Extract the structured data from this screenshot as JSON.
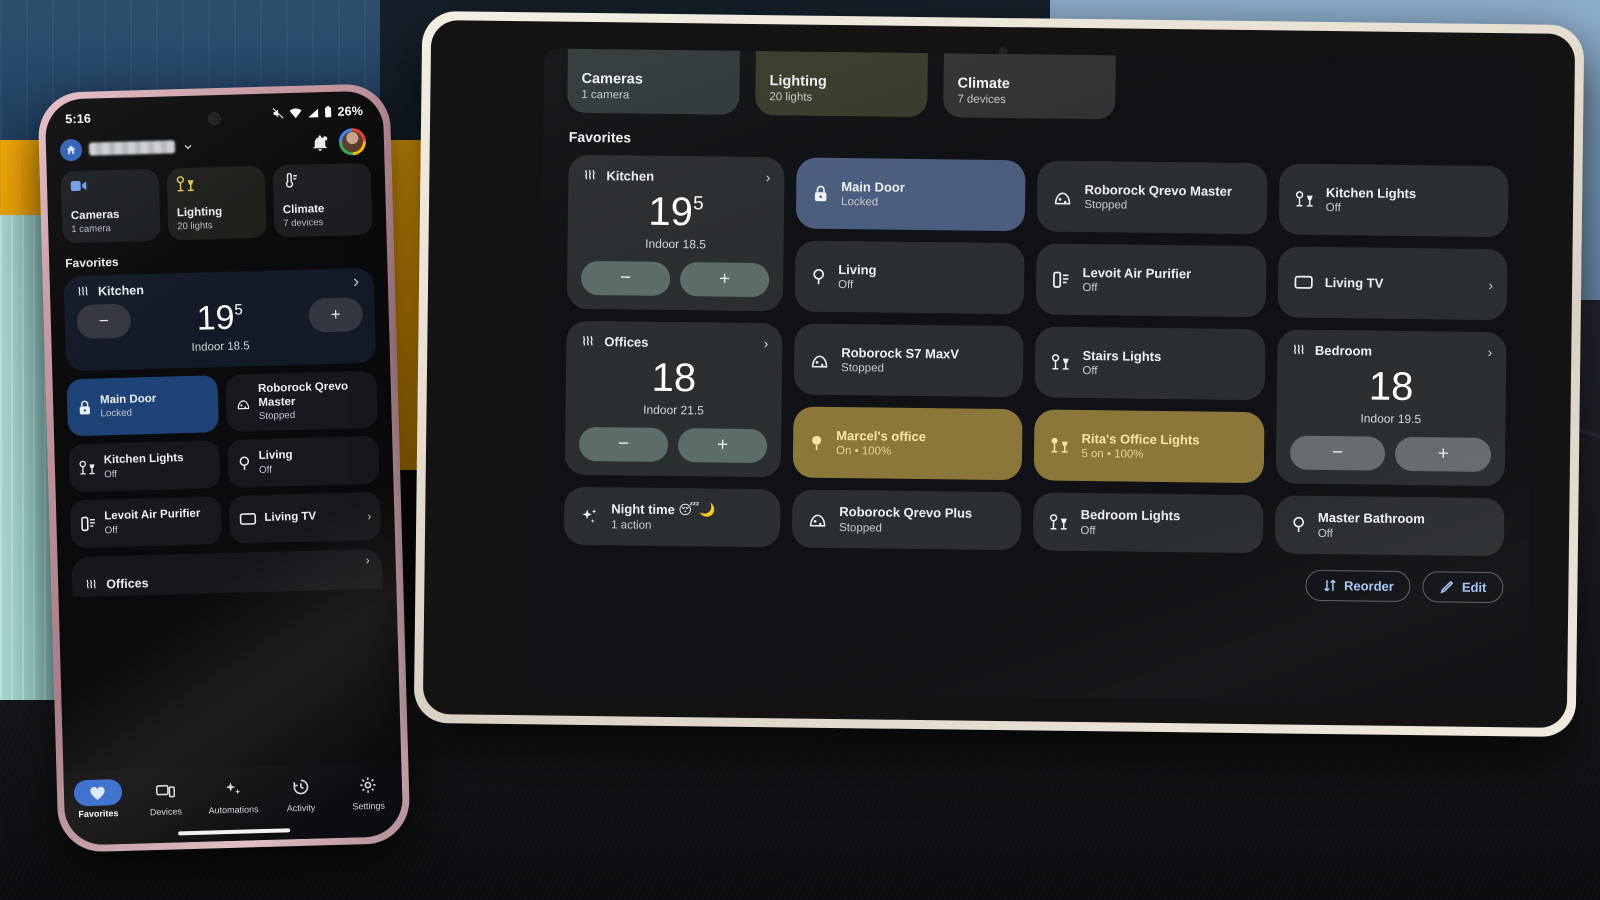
{
  "phone": {
    "status": {
      "time": "5:16",
      "battery": "26%",
      "icons": [
        "mute-icon",
        "wifi-icon",
        "signal-icon",
        "battery-icon"
      ]
    },
    "header": {
      "home_name_redacted": true,
      "notification_icon": "bell-icon",
      "avatar": "user-avatar"
    },
    "quick_cards": [
      {
        "title": "Cameras",
        "subtitle": "1 camera",
        "icon": "camera-icon"
      },
      {
        "title": "Lighting",
        "subtitle": "20 lights",
        "icon": "lamp-icon"
      },
      {
        "title": "Climate",
        "subtitle": "7 devices",
        "icon": "thermostat-icon"
      }
    ],
    "section_title": "Favorites",
    "thermostat": {
      "name": "Kitchen",
      "icon": "heat-waves-icon",
      "temp_whole": "19",
      "temp_frac": "5",
      "indoor": "Indoor 18.5",
      "minus_label": "−",
      "plus_label": "+",
      "chevron": "chevron-right-icon"
    },
    "tiles": [
      {
        "name": "Main Door",
        "state": "Locked",
        "icon": "lock-icon",
        "highlight": "locked"
      },
      {
        "name": "Roborock Qrevo Master",
        "state": "Stopped",
        "icon": "vacuum-icon",
        "highlight": "none"
      },
      {
        "name": "Kitchen Lights",
        "state": "Off",
        "icon": "lamp-icon",
        "highlight": "none"
      },
      {
        "name": "Living",
        "state": "Off",
        "icon": "bulb-icon",
        "highlight": "none"
      },
      {
        "name": "Levoit Air Purifier",
        "state": "Off",
        "icon": "air-purifier-icon",
        "highlight": "none"
      },
      {
        "name": "Living TV",
        "state": "",
        "icon": "tv-icon",
        "highlight": "none",
        "chevron": true
      }
    ],
    "offices_peek": {
      "name": "Offices",
      "icon": "heat-waves-icon",
      "chevron": "chevron-right-icon"
    },
    "nav": [
      {
        "label": "Favorites",
        "icon": "heart-icon",
        "active": true
      },
      {
        "label": "Devices",
        "icon": "devices-icon",
        "active": false
      },
      {
        "label": "Automations",
        "icon": "sparkle-icon",
        "active": false
      },
      {
        "label": "Activity",
        "icon": "history-icon",
        "active": false
      },
      {
        "label": "Settings",
        "icon": "gear-icon",
        "active": false
      }
    ]
  },
  "tablet": {
    "quick_cards": [
      {
        "title": "Cameras",
        "subtitle": "1 camera",
        "icon": "camera-icon"
      },
      {
        "title": "Lighting",
        "subtitle": "20 lights",
        "icon": "lamp-icon"
      },
      {
        "title": "Climate",
        "subtitle": "7 devices",
        "icon": "thermostat-icon"
      }
    ],
    "section_title": "Favorites",
    "thermostats": [
      {
        "name": "Kitchen",
        "icon": "heat-waves-icon",
        "temp_whole": "19",
        "temp_frac": "5",
        "indoor": "Indoor 18.5",
        "minus_label": "−",
        "plus_label": "+",
        "mode": "heat"
      },
      {
        "name": "Offices",
        "icon": "heat-waves-icon",
        "temp_whole": "18",
        "temp_frac": "",
        "indoor": "Indoor 21.5",
        "minus_label": "−",
        "plus_label": "+",
        "mode": "heat"
      },
      {
        "name": "Bedroom",
        "icon": "heat-waves-icon",
        "temp_whole": "18",
        "temp_frac": "",
        "indoor": "Indoor 19.5",
        "minus_label": "−",
        "plus_label": "+",
        "mode": "cool"
      }
    ],
    "tiles": [
      {
        "name": "Main Door",
        "state": "Locked",
        "icon": "lock-icon",
        "highlight": "locked",
        "chevron": false
      },
      {
        "name": "Roborock Qrevo Master",
        "state": "Stopped",
        "icon": "vacuum-icon",
        "highlight": "none",
        "chevron": false
      },
      {
        "name": "Kitchen Lights",
        "state": "Off",
        "icon": "lamp-icon",
        "highlight": "none",
        "chevron": false
      },
      {
        "name": "Living",
        "state": "Off",
        "icon": "bulb-icon",
        "highlight": "none",
        "chevron": false
      },
      {
        "name": "Levoit Air Purifier",
        "state": "Off",
        "icon": "air-purifier-icon",
        "highlight": "none",
        "chevron": false
      },
      {
        "name": "Living TV",
        "state": "",
        "icon": "tv-icon",
        "highlight": "none",
        "chevron": true
      },
      {
        "name": "Roborock S7 MaxV",
        "state": "Stopped",
        "icon": "vacuum-icon",
        "highlight": "none",
        "chevron": false
      },
      {
        "name": "Stairs Lights",
        "state": "Off",
        "icon": "lamp-icon",
        "highlight": "none",
        "chevron": false
      },
      {
        "name": "Marcel's office",
        "state": "On • 100%",
        "icon": "bulb-icon",
        "highlight": "lighton",
        "chevron": false
      },
      {
        "name": "Rita's Office Lights",
        "state": "5 on • 100%",
        "icon": "lamp-icon",
        "highlight": "lighton",
        "chevron": false
      },
      {
        "name": "Night time 😴🌙",
        "state": "1 action",
        "icon": "sparkle-icon",
        "highlight": "none",
        "chevron": false
      },
      {
        "name": "Roborock Qrevo Plus",
        "state": "Stopped",
        "icon": "vacuum-icon",
        "highlight": "none",
        "chevron": false
      },
      {
        "name": "Bedroom Lights",
        "state": "Off",
        "icon": "lamp-icon",
        "highlight": "none",
        "chevron": false
      },
      {
        "name": "Master Bathroom",
        "state": "Off",
        "icon": "bulb-icon",
        "highlight": "none",
        "chevron": false
      }
    ],
    "actions": [
      {
        "label": "Reorder",
        "icon": "reorder-icon"
      },
      {
        "label": "Edit",
        "icon": "pencil-icon"
      }
    ]
  },
  "colors": {
    "screen_bg": "#101114",
    "card_bg": "#2b2e31",
    "locked_blue": "#4b5d7e",
    "light_on_amber": "#8b7739",
    "light_on_text": "#f7e7a8",
    "accent_blue": "#a8c7fa",
    "heat_button": "#5b6d66",
    "cool_button": "#666b6f",
    "phone_card_bg": "#16181d",
    "phone_locked_blue": "#1d4276",
    "phone_accent": "#2f6ad0"
  }
}
